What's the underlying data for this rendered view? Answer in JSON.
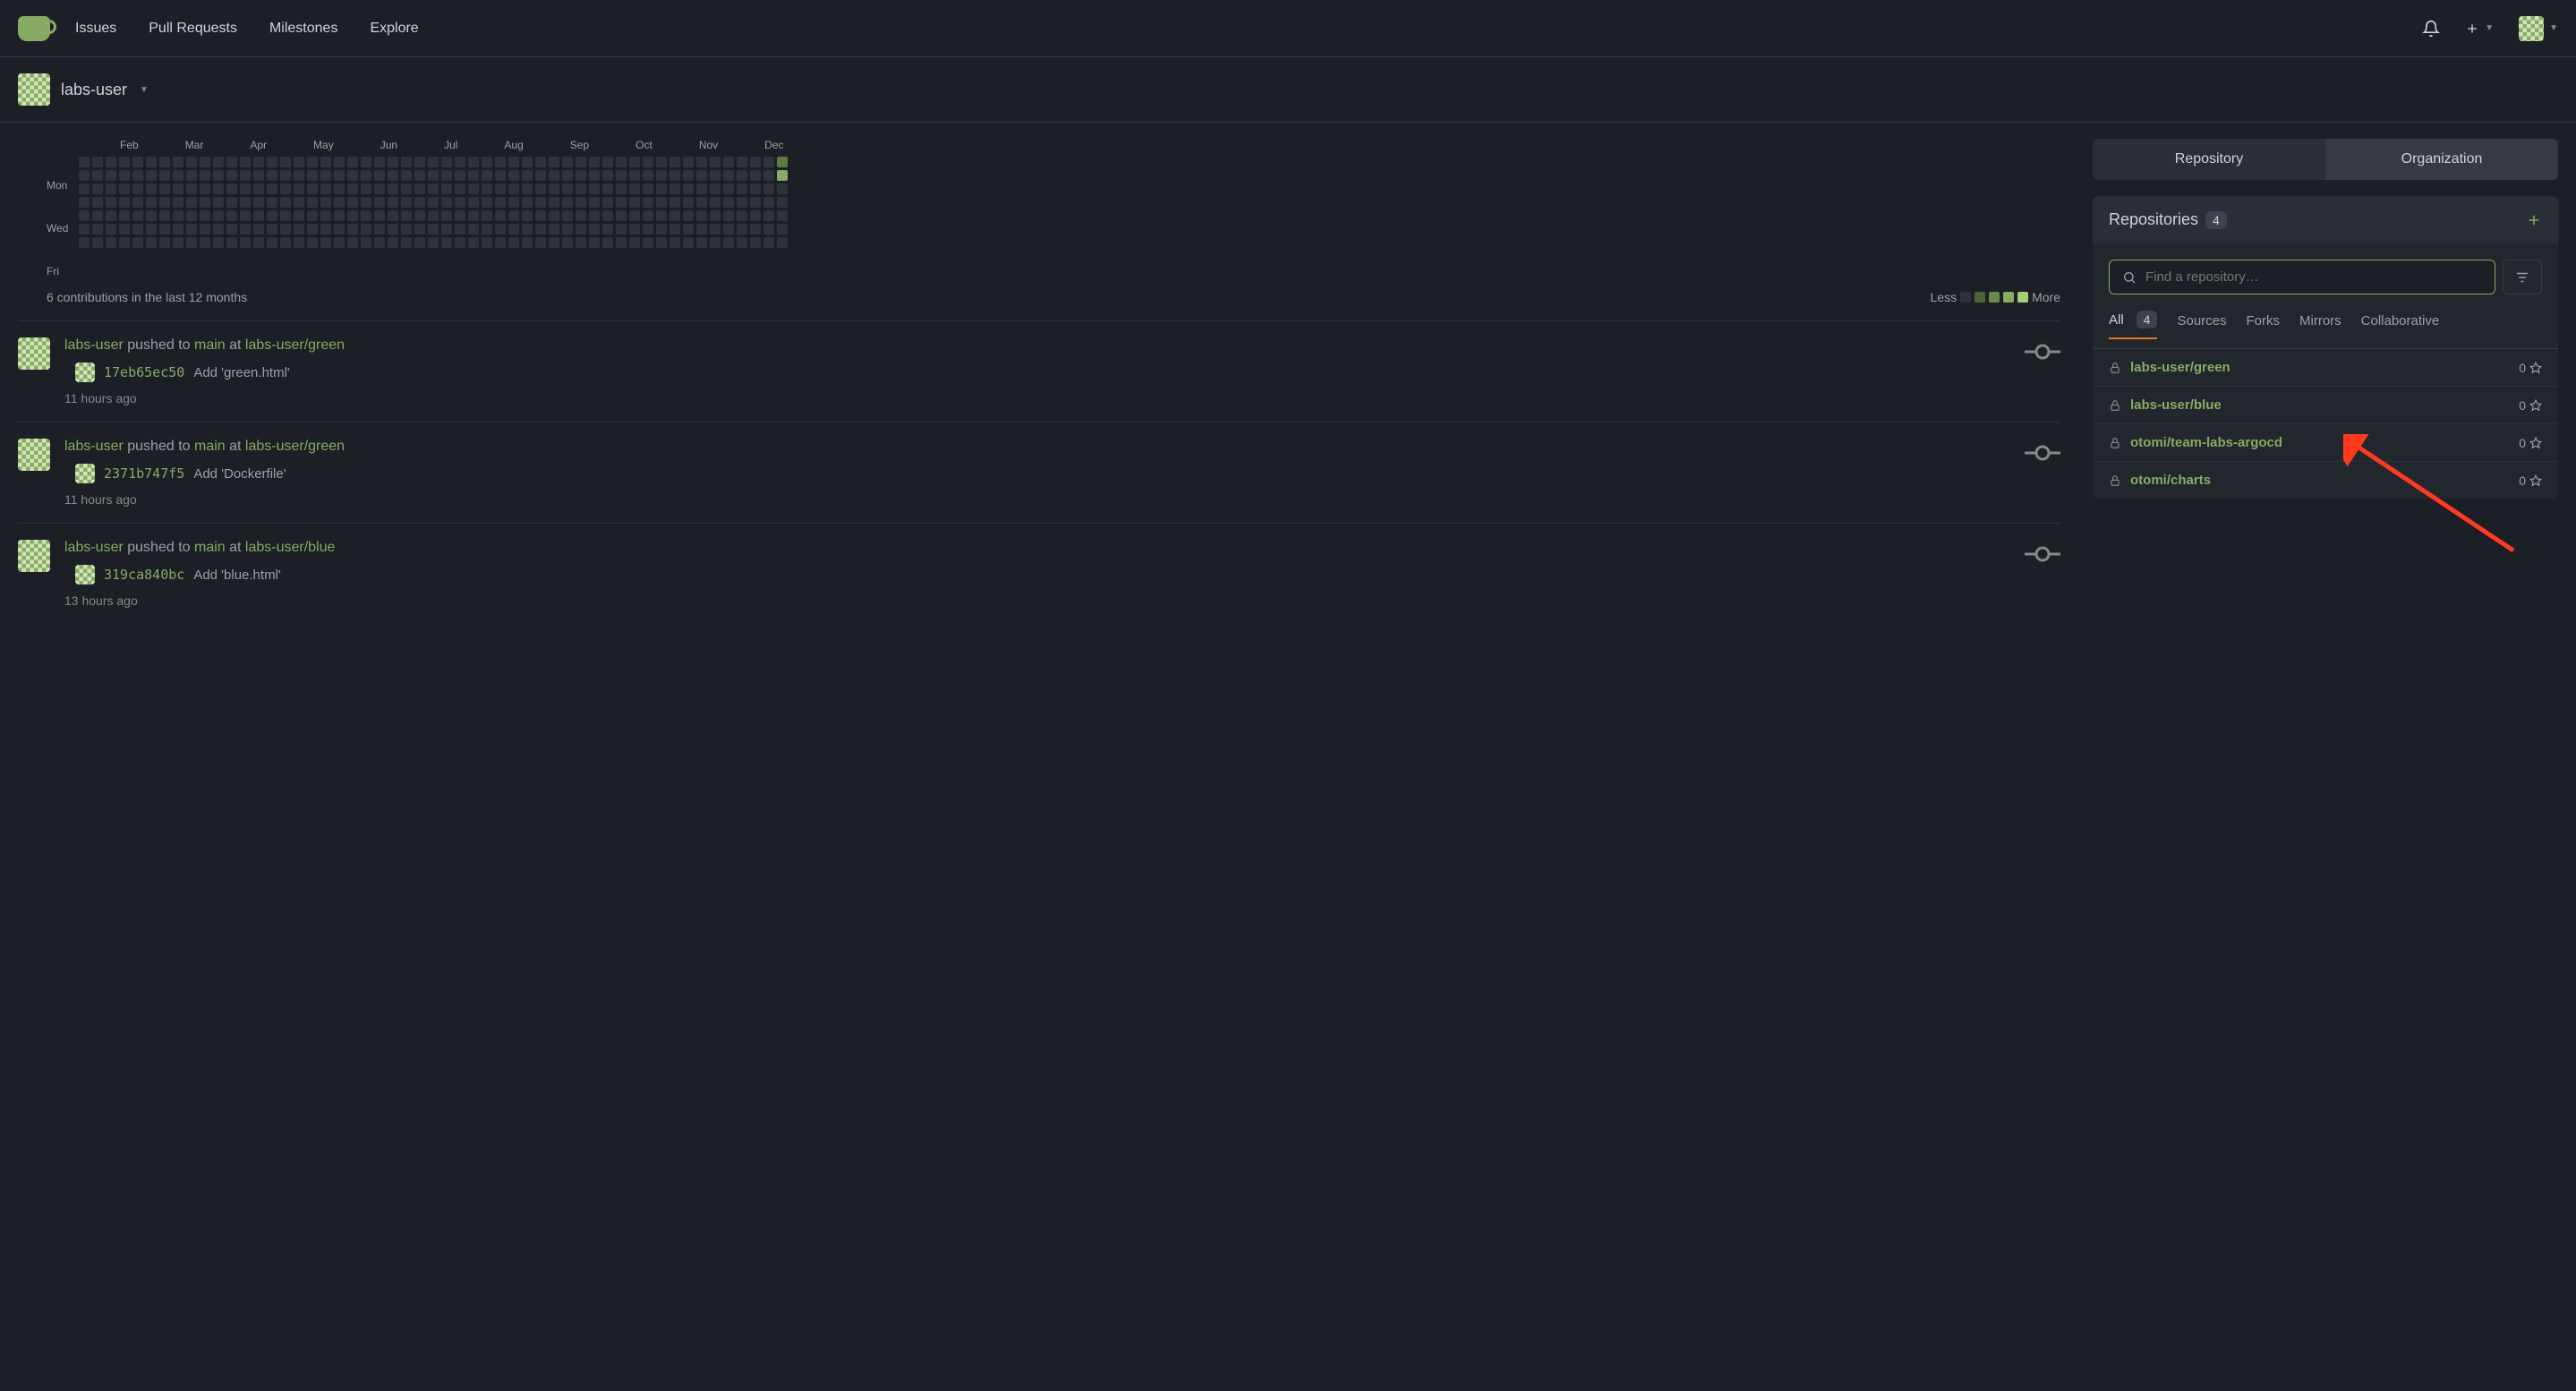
{
  "nav": {
    "items": [
      "Issues",
      "Pull Requests",
      "Milestones",
      "Explore"
    ]
  },
  "user": {
    "name": "labs-user"
  },
  "heatmap": {
    "months": [
      "Feb",
      "Mar",
      "Apr",
      "May",
      "Jun",
      "Jul",
      "Aug",
      "Sep",
      "Oct",
      "Nov",
      "Dec"
    ],
    "days": [
      "Mon",
      "Wed",
      "Fri"
    ],
    "summary": "6 contributions in the last 12 months",
    "legend_less": "Less",
    "legend_more": "More"
  },
  "activity": [
    {
      "user": "labs-user",
      "action": "pushed to",
      "branch": "main",
      "at": "at",
      "repo": "labs-user/green",
      "sha": "17eb65ec50",
      "msg": "Add 'green.html'",
      "time": "11 hours ago"
    },
    {
      "user": "labs-user",
      "action": "pushed to",
      "branch": "main",
      "at": "at",
      "repo": "labs-user/green",
      "sha": "2371b747f5",
      "msg": "Add 'Dockerfile'",
      "time": "11 hours ago"
    },
    {
      "user": "labs-user",
      "action": "pushed to",
      "branch": "main",
      "at": "at",
      "repo": "labs-user/blue",
      "sha": "319ca840bc",
      "msg": "Add 'blue.html'",
      "time": "13 hours ago"
    }
  ],
  "right": {
    "tabs": {
      "repository": "Repository",
      "organization": "Organization"
    },
    "panel_title": "Repositories",
    "count": "4",
    "search_placeholder": "Find a repository…",
    "filters": {
      "all": "All",
      "all_count": "4",
      "sources": "Sources",
      "forks": "Forks",
      "mirrors": "Mirrors",
      "collaborative": "Collaborative"
    },
    "repos": [
      {
        "name": "labs-user/green",
        "stars": "0"
      },
      {
        "name": "labs-user/blue",
        "stars": "0"
      },
      {
        "name": "otomi/team-labs-argocd",
        "stars": "0"
      },
      {
        "name": "otomi/charts",
        "stars": "0"
      }
    ]
  }
}
